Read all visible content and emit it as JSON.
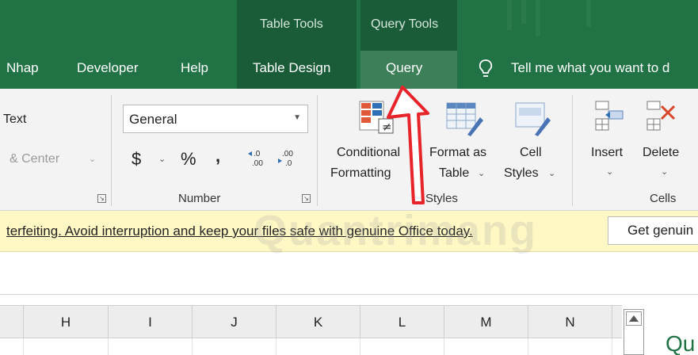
{
  "title_band": {
    "context_table": "Table Tools",
    "context_query": "Query Tools",
    "tabs": [
      "Nhap",
      "Developer",
      "Help",
      "Table Design",
      "Query"
    ],
    "tell_me": "Tell me what you want to d"
  },
  "ribbon": {
    "text_fragment": "Text",
    "merge_fragment": "& Center",
    "number_format_value": "General",
    "number_symbols": {
      "currency": "$",
      "percent": "%",
      "comma": ",",
      "inc_decimal": ".0\n.00",
      "dec_decimal": ".00\n→.0"
    },
    "number_group_label": "Number",
    "styles": {
      "conditional_line1": "Conditional",
      "conditional_line2": "Formatting",
      "format_as_line1": "Format as",
      "format_as_line2": "Table",
      "cell_styles_line1": "Cell",
      "cell_styles_line2": "Styles",
      "group_label": "Styles"
    },
    "cells": {
      "insert": "Insert",
      "delete": "Delete",
      "group_label": "Cells"
    }
  },
  "message_bar": {
    "text": "terfeiting. Avoid interruption and keep your files safe with genuine Office today.",
    "button": "Get genuin"
  },
  "grid": {
    "columns": [
      "H",
      "I",
      "J",
      "K",
      "L",
      "M",
      "N"
    ],
    "side_panel_text": "Qu"
  },
  "watermark": "Quantrimang",
  "colors": {
    "excel_green": "#217346",
    "arrow_red": "#e8242b"
  }
}
